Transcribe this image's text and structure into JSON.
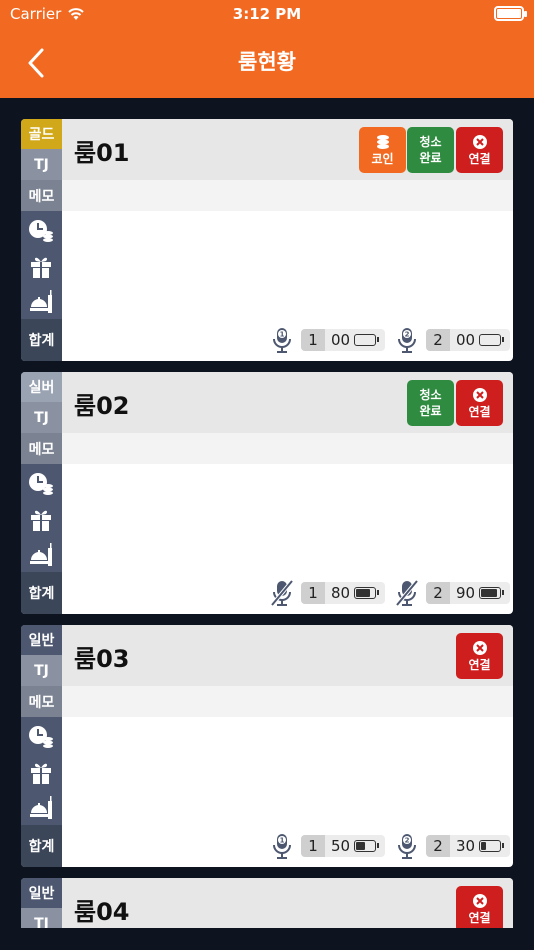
{
  "status_bar": {
    "carrier": "Carrier",
    "time": "3:12 PM"
  },
  "header": {
    "title": "룸현황",
    "back_icon": "chevron-left-icon"
  },
  "labels": {
    "tj": "TJ",
    "memo": "메모",
    "sum": "합계"
  },
  "buttons": {
    "coin": "코인",
    "clean_line1": "청소",
    "clean_line2": "완료",
    "connect": "연결"
  },
  "colors": {
    "header": "#f26a22",
    "gold": "#d2a81b",
    "silver": "#9aa3b2",
    "normal": "#4d5870",
    "coin": "#f26a22",
    "clean": "#2e8b3f",
    "connect": "#cf1e1e"
  },
  "rooms": [
    {
      "grade": "골드",
      "name": "룸01",
      "mics": [
        {
          "num": "1",
          "value": "00",
          "battery": 0,
          "muted": false
        },
        {
          "num": "2",
          "value": "00",
          "battery": 0,
          "muted": false
        }
      ]
    },
    {
      "grade": "실버",
      "name": "룸02",
      "mics": [
        {
          "num": "1",
          "value": "80",
          "battery": 0.8,
          "muted": true
        },
        {
          "num": "2",
          "value": "90",
          "battery": 0.9,
          "muted": true
        }
      ]
    },
    {
      "grade": "일반",
      "name": "룸03",
      "mics": [
        {
          "num": "1",
          "value": "50",
          "battery": 0.5,
          "muted": false
        },
        {
          "num": "2",
          "value": "30",
          "battery": 0.3,
          "muted": false
        }
      ]
    },
    {
      "grade": "일반",
      "name": "룸04"
    }
  ]
}
